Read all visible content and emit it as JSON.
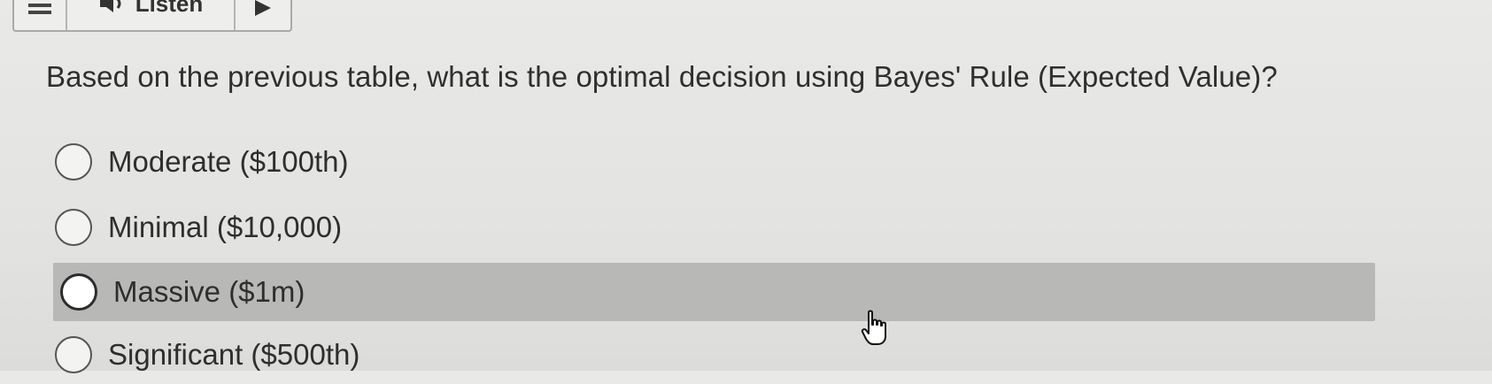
{
  "toolbar": {
    "menu_icon": "hamburger-menu-icon",
    "listen_icon": "speaker-icon",
    "listen_label": "Listen",
    "play_icon": "play-icon"
  },
  "question": {
    "text": "Based on the previous table, what is the optimal decision using Bayes' Rule (Expected Value)?"
  },
  "options": [
    {
      "label": "Moderate ($100th)",
      "highlighted": false
    },
    {
      "label": "Minimal ($10,000)",
      "highlighted": false
    },
    {
      "label": "Massive ($1m)",
      "highlighted": true
    },
    {
      "label": "Significant ($500th)",
      "highlighted": false
    }
  ],
  "cursor": {
    "icon": "hand-pointer-cursor-icon"
  },
  "colors": {
    "background": "#e6e6e4",
    "highlight": "#b8b8b6",
    "text": "#2f2f2f"
  }
}
